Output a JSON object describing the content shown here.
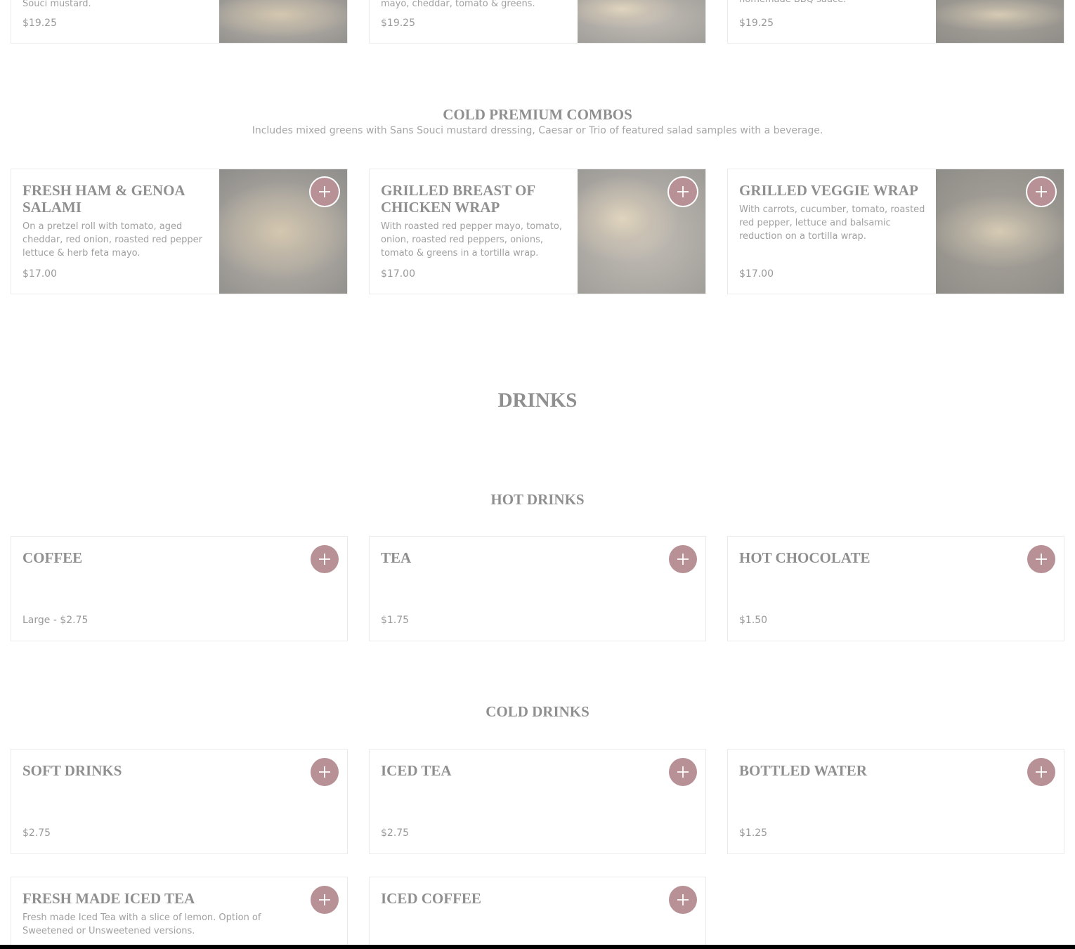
{
  "top_row": [
    {
      "desc_tail": "Souci mustard.",
      "price": "$19.25"
    },
    {
      "desc_tail": "mayo, cheddar, tomato & greens.",
      "price": "$19.25"
    },
    {
      "desc_tail": "homemade BBQ sauce.",
      "price": "$19.25"
    }
  ],
  "cold_premium": {
    "heading": "COLD PREMIUM COMBOS",
    "subheading": "Includes mixed greens with Sans Souci mustard dressing, Caesar or Trio of featured salad samples with a beverage.",
    "items": [
      {
        "name": "FRESH HAM & GENOA SALAMI",
        "desc": "On a pretzel roll with tomato, aged cheddar, red onion, roasted red pepper lettuce & herb feta mayo.",
        "price": "$17.00"
      },
      {
        "name": "GRILLED BREAST OF CHICKEN WRAP",
        "desc": "With roasted red pepper mayo, tomato, onion, roasted red peppers, onions, tomato & greens in a tortilla wrap.",
        "price": "$17.00"
      },
      {
        "name": "GRILLED VEGGIE WRAP",
        "desc": "With carrots, cucumber, tomato, roasted red pepper, lettuce and balsamic reduction on a tortilla wrap.",
        "price": "$17.00"
      }
    ]
  },
  "drinks": {
    "heading": "DRINKS",
    "hot": {
      "heading": "HOT DRINKS",
      "items": [
        {
          "name": "COFFEE",
          "price": "Large - $2.75"
        },
        {
          "name": "TEA",
          "price": "$1.75"
        },
        {
          "name": "HOT CHOCOLATE",
          "price": "$1.50"
        }
      ]
    },
    "cold": {
      "heading": "COLD DRINKS",
      "items": [
        {
          "name": "SOFT DRINKS",
          "price": "$2.75"
        },
        {
          "name": "ICED TEA",
          "price": "$2.75"
        },
        {
          "name": "BOTTLED WATER",
          "price": "$1.25"
        },
        {
          "name": "FRESH MADE ICED TEA",
          "desc": "Fresh made Iced Tea with a slice of lemon. Option of Sweetened or Unsweetened versions."
        },
        {
          "name": "ICED COFFEE"
        }
      ]
    }
  },
  "icons": {
    "add": "plus-icon"
  },
  "colors": {
    "add_button": "#b79196",
    "heading": "#8f8f8f"
  }
}
